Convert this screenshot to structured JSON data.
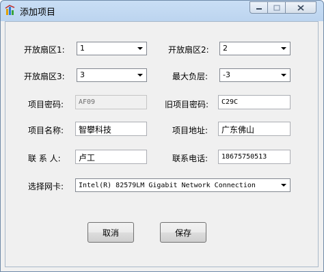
{
  "window": {
    "title": "添加项目"
  },
  "form": {
    "sector1": {
      "label": "开放扇区1:",
      "value": "1"
    },
    "sector2": {
      "label": "开放扇区2:",
      "value": "2"
    },
    "sector3": {
      "label": "开放扇区3:",
      "value": "3"
    },
    "max_floor": {
      "label": "最大负层:",
      "value": "-3"
    },
    "project_password": {
      "label": "项目密码:",
      "value": "AF09"
    },
    "old_project_password": {
      "label": "旧项目密码:",
      "value": "C29C"
    },
    "project_name": {
      "label": "项目名称:",
      "value": "智攀科技"
    },
    "project_address": {
      "label": "项目地址:",
      "value": "广东佛山"
    },
    "contact": {
      "label": "联 系 人:",
      "value": "卢工"
    },
    "phone": {
      "label": "联系电话:",
      "value": "18675750513"
    },
    "nic": {
      "label": "选择网卡:",
      "value": "Intel(R) 82579LM Gigabit Network Connection"
    }
  },
  "buttons": {
    "cancel": "取消",
    "save": "保存"
  },
  "colors": {
    "title_gradient_top": "#c9def5",
    "client_bg": "#f0f0f0"
  }
}
